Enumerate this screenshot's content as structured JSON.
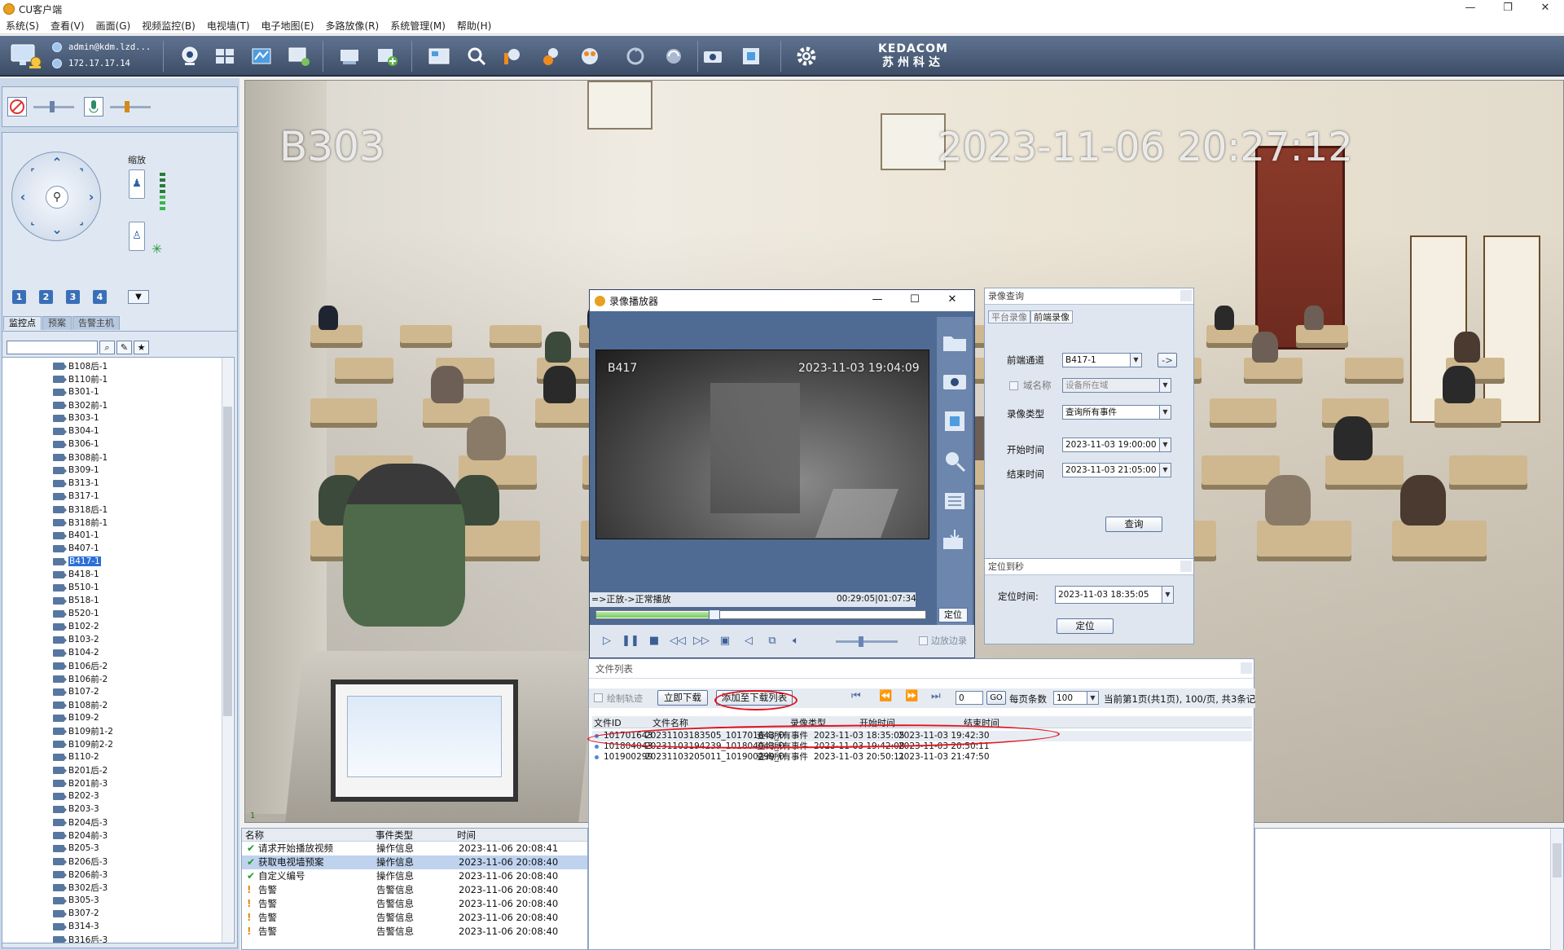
{
  "window": {
    "title": "CU客户端",
    "minimize": "—",
    "restore": "❐",
    "close": "✕"
  },
  "menu": [
    "系统(S)",
    "查看(V)",
    "画面(G)",
    "视频监控(B)",
    "电视墙(T)",
    "电子地图(E)",
    "多路放像(R)",
    "系统管理(M)",
    "帮助(H)"
  ],
  "toolbar": {
    "user": "admin@kdm.lzd...",
    "ip": "172.17.17.14",
    "brand_en": "KEDACOM",
    "brand_cn": "苏州科达",
    "icons": [
      "monitor-icon",
      "layout-icon",
      "map-icon",
      "tv-wall-icon",
      "record-icon",
      "add-device-icon",
      "playback-icon",
      "search-icon",
      "alarm-icon",
      "user-icon",
      "group-icon",
      "sync-icon",
      "refresh-icon",
      "snapshot-icon",
      "fullscreen-icon",
      "settings-icon"
    ]
  },
  "left_panel": {
    "zoom_label": "缩放",
    "presets": [
      "1",
      "2",
      "3",
      "4"
    ],
    "tabs": [
      "监控点",
      "预案",
      "告警主机"
    ],
    "search_placeholder": "",
    "tree": [
      "B108后-1",
      "B110前-1",
      "B301-1",
      "B302前-1",
      "B303-1",
      "B304-1",
      "B306-1",
      "B308前-1",
      "B309-1",
      "B313-1",
      "B317-1",
      "B318后-1",
      "B318前-1",
      "B401-1",
      "B407-1",
      "B417-1",
      "B418-1",
      "B510-1",
      "B518-1",
      "B520-1",
      "B102-2",
      "B103-2",
      "B104-2",
      "B106后-2",
      "B106前-2",
      "B107-2",
      "B108前-2",
      "B109-2",
      "B109前1-2",
      "B109前2-2",
      "B110-2",
      "B201后-2",
      "B201前-3",
      "B202-3",
      "B203-3",
      "B204后-3",
      "B204前-3",
      "B205-3",
      "B206后-3",
      "B206前-3",
      "B302后-3",
      "B305-3",
      "B307-2",
      "B314-3",
      "B316后-3"
    ],
    "tree_selected": "B417-1"
  },
  "main_video": {
    "room": "B303",
    "timestamp": "2023-11-06  20:27:12",
    "channel": "B303-1",
    "pane_index": "1"
  },
  "playback": {
    "title": "录像播放器",
    "room": "B417",
    "timestamp": "2023-11-03  19:04:09",
    "status": "=>正放->正常播放",
    "timecode": "00:29:05|01:07:34",
    "progress": 0.36,
    "locate_btn": "定位",
    "boundary_label": "边放边录"
  },
  "record_query": {
    "title": "录像查询",
    "tabs": [
      "平台录像",
      "前端录像"
    ],
    "channel_label": "前端通道",
    "channel_value": "B417-1",
    "go_btn": "->",
    "domain_label": "域名称",
    "domain_value": "设备所在域",
    "type_label": "录像类型",
    "type_value": "查询所有事件",
    "start_label": "开始时间",
    "start_value": "2023-11-03 19:00:00",
    "end_label": "结束时间",
    "end_value": "2023-11-03 21:05:00",
    "query_btn": "查询"
  },
  "locate": {
    "title": "定位到秒",
    "label": "定位时间:",
    "value": "2023-11-03  18:35:05",
    "btn": "定位"
  },
  "file_list": {
    "title": "文件列表",
    "draw_track": "绘制轨迹",
    "download_now": "立即下载",
    "add_download": "添加至下载列表",
    "page_input": "0",
    "go": "GO",
    "per_page_label": "每页条数",
    "per_page": "100",
    "page_info": "当前第1页(共1页), 100/页, 共3条记",
    "columns": [
      "文件ID",
      "文件名称",
      "录像类型",
      "开始时间",
      "结束时间"
    ],
    "rows": [
      [
        "101701643",
        "20231103183505_101701643_0",
        "查询所有事件",
        "2023-11-03  18:35:05",
        "2023-11-03  19:42:30"
      ],
      [
        "101804043",
        "20231103194239_101804043_0",
        "查询所有事件",
        "2023-11-03  19:42:08",
        "2023-11-03  20:50:11"
      ],
      [
        "101900299",
        "20231103205011_101900299_0",
        "查询所有事件",
        "2023-11-03  20:50:11",
        "2023-11-03  21:47:50"
      ]
    ]
  },
  "log": {
    "columns": [
      "名称",
      "事件类型",
      "时间"
    ],
    "rows": [
      {
        "icon": "check",
        "name": "请求开始播放视频",
        "type": "操作信息",
        "time": "2023-11-06  20:08:41"
      },
      {
        "icon": "check",
        "name": "获取电视墙预案",
        "type": "操作信息",
        "time": "2023-11-06  20:08:40",
        "selected": true
      },
      {
        "icon": "check",
        "name": "自定义编号",
        "type": "操作信息",
        "time": "2023-11-06  20:08:40"
      },
      {
        "icon": "warn",
        "name": "告警",
        "type": "告警信息",
        "time": "2023-11-06  20:08:40"
      },
      {
        "icon": "warn",
        "name": "告警",
        "type": "告警信息",
        "time": "2023-11-06  20:08:40"
      },
      {
        "icon": "warn",
        "name": "告警",
        "type": "告警信息",
        "time": "2023-11-06  20:08:40"
      },
      {
        "icon": "warn",
        "name": "告警",
        "type": "告警信息",
        "time": "2023-11-06  20:08:40"
      }
    ]
  },
  "colors": {
    "toolbar": "#4d5f7a",
    "highlight": "#e1131f",
    "selection": "#2d6fd6"
  }
}
